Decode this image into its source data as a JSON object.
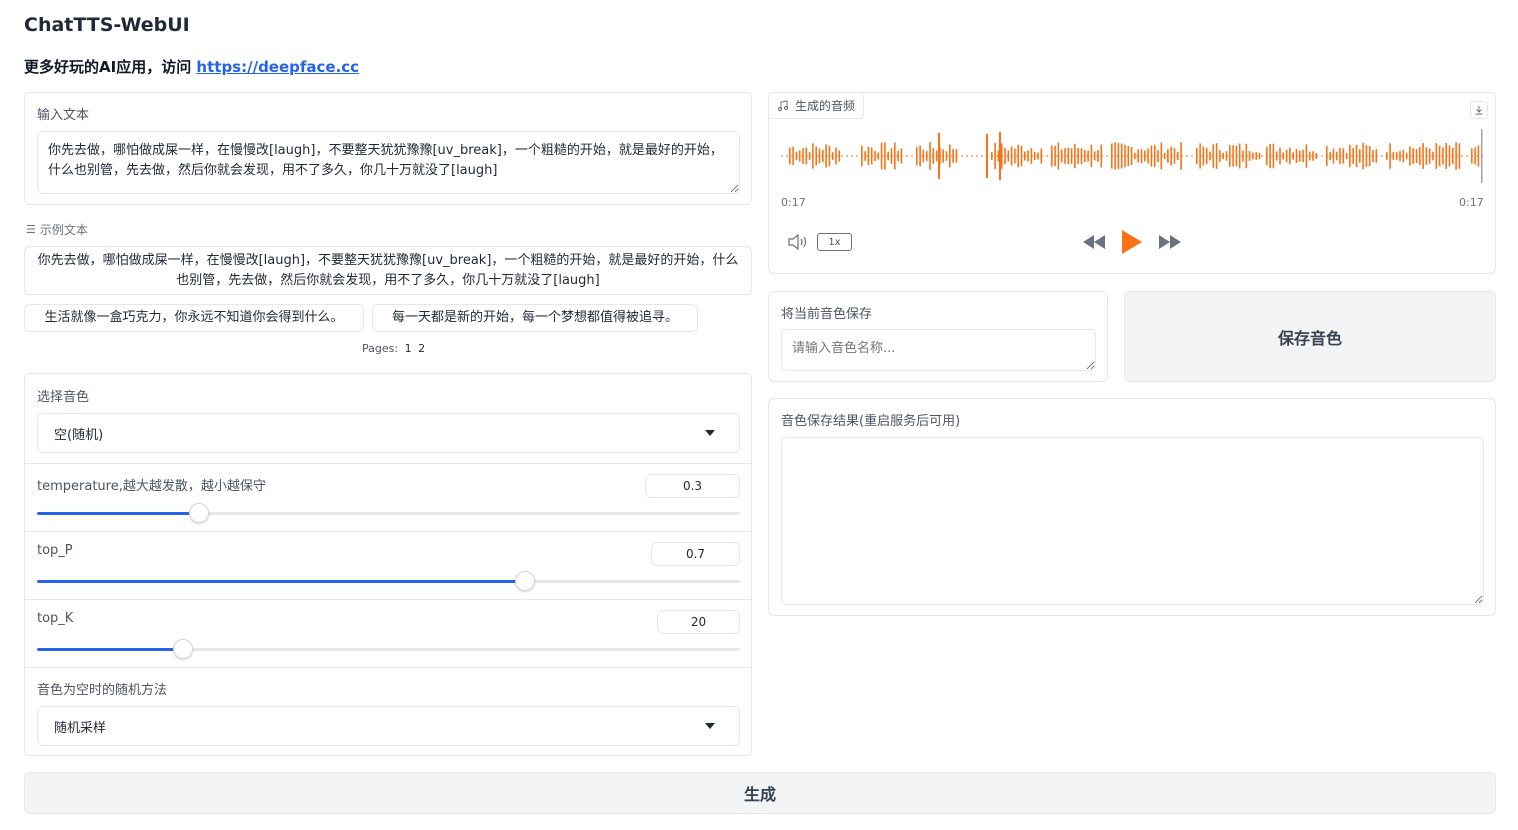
{
  "app": {
    "title": "ChatTTS-WebUI",
    "subtitle_text": "更多好玩的AI应用，访问 ",
    "subtitle_link": "https://deepface.cc"
  },
  "input": {
    "label": "输入文本",
    "value": "你先去做，哪怕做成屎一样，在慢慢改[laugh]，不要整天犹犹豫豫[uv_break]，一个粗糙的开始，就是最好的开始，什么也别管，先去做，然后你就会发现，用不了多久，你几十万就没了[laugh]"
  },
  "examples": {
    "label": "示例文本",
    "items": [
      "你先去做，哪怕做成屎一样，在慢慢改[laugh]，不要整天犹犹豫豫[uv_break]，一个粗糙的开始，就是最好的开始，什么也别管，先去做，然后你就会发现，用不了多久，你几十万就没了[laugh]",
      "生活就像一盒巧克力，你永远不知道你会得到什么。",
      "每一天都是新的开始，每一个梦想都值得被追寻。"
    ],
    "pages_label": "Pages:",
    "pages": [
      "1",
      "2"
    ]
  },
  "voice": {
    "label": "选择音色",
    "selected": "空(随机)"
  },
  "temperature": {
    "label": "temperature,越大越发散，越小越保守",
    "value": "0.3",
    "min": 1e-05,
    "max": 1,
    "fraction": 0.23
  },
  "top_p": {
    "label": "top_P",
    "value": "0.7",
    "fraction": 0.694
  },
  "top_k": {
    "label": "top_K",
    "value": "20",
    "fraction": 0.207
  },
  "random_method": {
    "label": "音色为空时的随机方法",
    "selected": "随机采样"
  },
  "audio": {
    "label": "生成的音频",
    "current_time": "0:17",
    "duration": "0:17",
    "speed": "1x",
    "color": "#f97316",
    "icons": [
      "music-note-icon",
      "download-icon",
      "volume-icon",
      "rewind-icon",
      "play-icon",
      "fast-forward-icon"
    ]
  },
  "save_voice": {
    "label": "将当前音色保存",
    "placeholder": "请输入音色名称...",
    "button": "保存音色"
  },
  "save_result": {
    "label": "音色保存结果(重启服务后可用)"
  },
  "generate": {
    "button": "生成"
  },
  "colors": {
    "accent": "#2563eb",
    "audio": "#f97316",
    "border": "#e5e7eb"
  }
}
